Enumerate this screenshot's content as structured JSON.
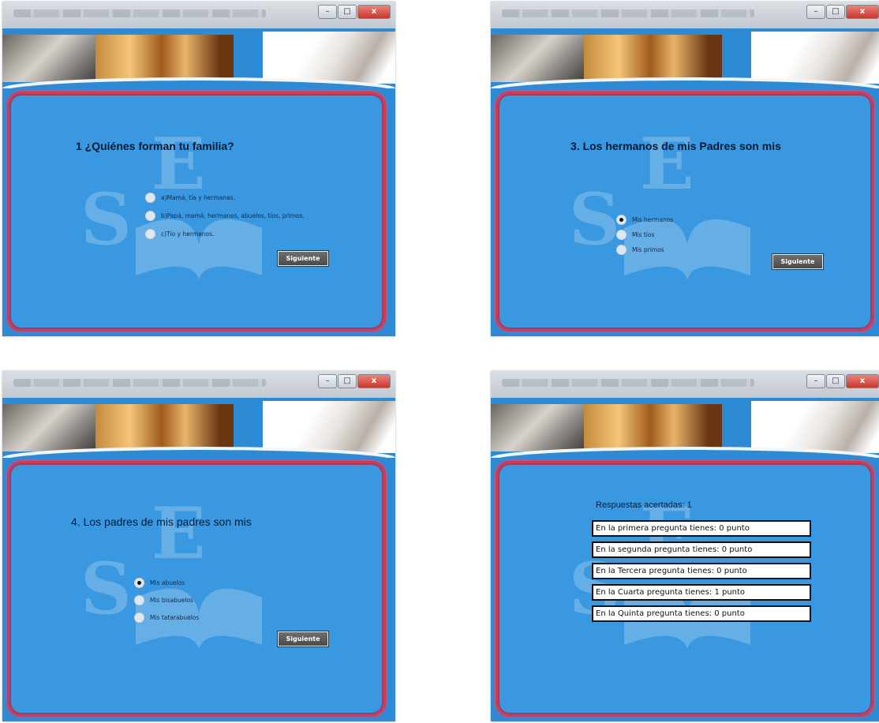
{
  "windows": [
    {
      "question": "1 ¿Quiénes forman tu familia?",
      "options": [
        {
          "label": "a)Mamá, tía y hermanas.",
          "selected": false
        },
        {
          "label": "b)Papá, mamá, hermanos, abuelos, tíos, primos.",
          "selected": false
        },
        {
          "label": "c)Tío y hermanos.",
          "selected": false
        }
      ],
      "next_label": "Siguiente"
    },
    {
      "question": "3. Los hermanos de mis Padres son mis",
      "options": [
        {
          "label": "Mis hermanos",
          "selected": true
        },
        {
          "label": "Mis tíos",
          "selected": false
        },
        {
          "label": "Mis primos",
          "selected": false
        }
      ],
      "next_label": "Siguiente"
    },
    {
      "question": "4. Los padres de mis padres son mis",
      "options": [
        {
          "label": "Mis abuelos",
          "selected": true
        },
        {
          "label": "Mis bisabuelos",
          "selected": false
        },
        {
          "label": "Mis tatarabuelos",
          "selected": false
        }
      ],
      "next_label": "Siguiente"
    },
    {
      "results_title": "Respuestas acertadas:  1",
      "results": [
        "En la primera pregunta tienes: 0 punto",
        "En la segunda pregunta tienes: 0 punto",
        "En la Tercera pregunta tienes: 0 punto",
        "En la Cuarta pregunta tienes: 1 punto",
        "En la Quinta pregunta tienes: 0 punto"
      ]
    }
  ],
  "window_controls": {
    "minimize": "–",
    "maximize": "□",
    "close": "x"
  },
  "colors": {
    "panel": "#3a98e0",
    "frame": "#d33b4a",
    "button": "#555555"
  }
}
